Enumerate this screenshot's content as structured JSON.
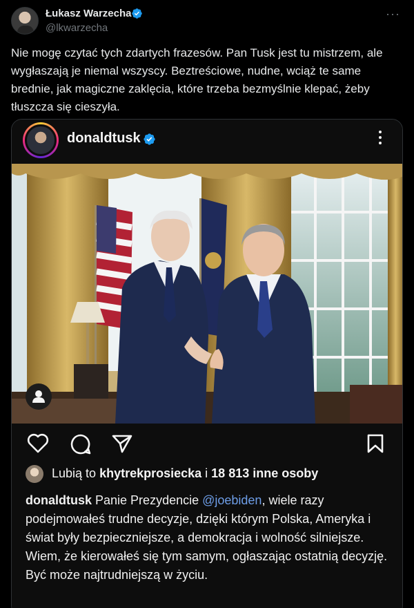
{
  "tweet": {
    "author_name": "Łukasz Warzecha",
    "handle": "@lkwarzecha",
    "more_label": "···",
    "text": "Nie mogę czytać tych zdartych frazesów. Pan Tusk jest tu mistrzem, ale wygłaszają je niemal wszyscy. Beztreściowe, nudne, wciąż te same brednie, jak magiczne zaklęcia, które trzeba bezmyślnie klepać, żeby tłuszcza się cieszyła."
  },
  "embedded_post": {
    "username": "donaldtusk",
    "likes": {
      "prefix": "Lubią to ",
      "user": "khytrekprosiecka",
      "middle": " i ",
      "count": "18 813",
      "suffix": " inne osoby"
    },
    "caption": {
      "user": "donaldtusk",
      "before_mention": " Panie Prezydencie ",
      "mention": "@joebiden",
      "after_mention": ", wiele razy podejmowałeś trudne decyzje, dzięki którym Polska, Ameryka i świat były bezpieczniejsze, a demokracja i wolność silniejsze. Wiem, że kierowałeś się tym samym, ogłaszając ostatnią decyzję. Być może najtrudniejszą w życiu."
    }
  },
  "colors": {
    "background": "#000000",
    "text": "#e7e9ea",
    "muted": "#71767b",
    "verified": "#1d9bf0",
    "mention": "#6e9ee8"
  },
  "icons": [
    "verified-badge-icon",
    "more-icon",
    "heart-icon",
    "comment-icon",
    "share-icon",
    "bookmark-icon",
    "user-icon"
  ]
}
